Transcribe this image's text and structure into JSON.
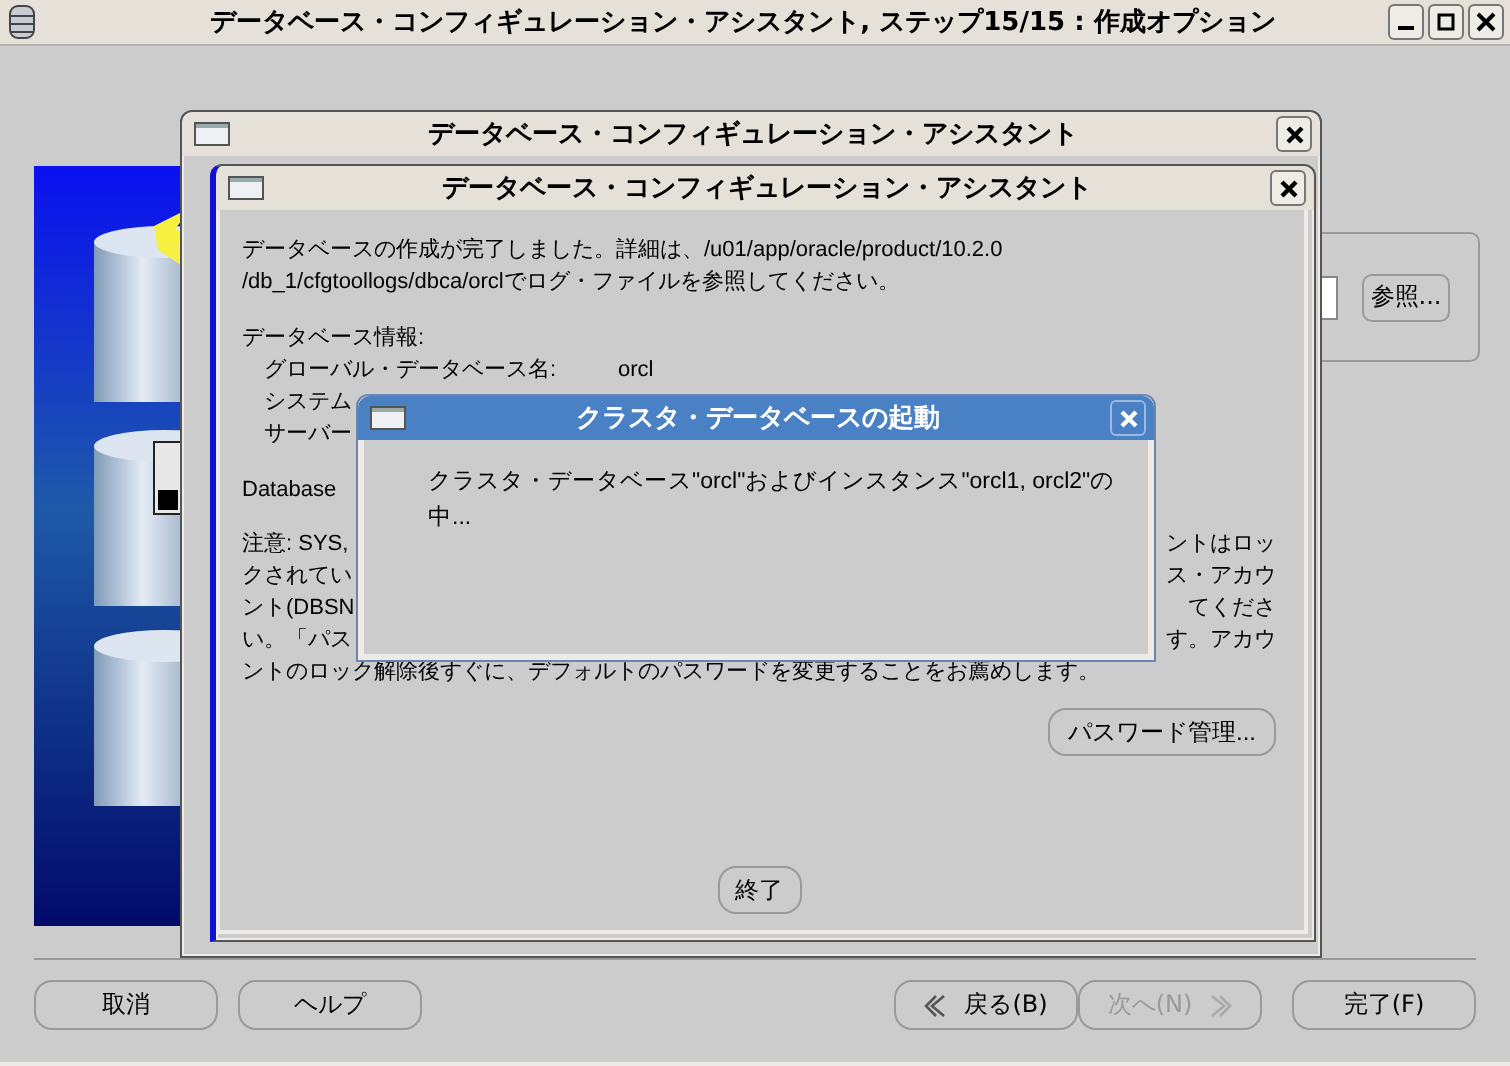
{
  "main_window": {
    "title": "データベース・コンフィギュレーション・アシスタント, ステップ15/15 : 作成オプション",
    "browse_button": "参照...",
    "buttons": [
      {
        "label": "取消",
        "disabled": false,
        "kind": "plain"
      },
      {
        "label": "ヘルプ",
        "disabled": false,
        "kind": "plain"
      },
      {
        "label": "戻る(B)",
        "disabled": false,
        "kind": "back"
      },
      {
        "label": "次へ(N)",
        "disabled": true,
        "kind": "next"
      },
      {
        "label": "完了(F)",
        "disabled": false,
        "kind": "plain"
      }
    ]
  },
  "dialog": {
    "title": "データベース・コンフィギュレーション・アシスタント"
  },
  "inner_dialog": {
    "title": "データベース・コンフィギュレーション・アシスタント",
    "message_lines": [
      "データベースの作成が完了しました。詳細は、/u01/app/oracle/product/10.2.0",
      "/db_1/cfgtoollogs/dbca/orclでログ・ファイルを参照してください。"
    ],
    "info_heading": "データベース情報:",
    "info_rows": [
      {
        "label": "グローバル・データベース名:",
        "value": "orcl"
      },
      {
        "label": "システム"
      },
      {
        "label": "サーバー"
      }
    ],
    "database_label": "Database",
    "note_lines": [
      {
        "left": "注意: SYS,",
        "right": "ントはロッ"
      },
      {
        "left": "クされてい",
        "right": "ス・アカウ"
      },
      {
        "left": "ント(DBSN",
        "right": "てくださ"
      },
      {
        "left": "い。「パス",
        "right": "す。アカウ"
      },
      {
        "left": "ントのロック解除後すぐに、デフォルトのパスワードを変更することをお薦めします。"
      }
    ],
    "password_button": "パスワード管理...",
    "exit_button": "終了"
  },
  "cluster_dialog": {
    "title": "クラスタ・データベースの起動",
    "message_lines": [
      "クラスタ・データベース\"orcl\"およびインスタンス\"orcl1, orcl2\"の",
      "中..."
    ]
  }
}
